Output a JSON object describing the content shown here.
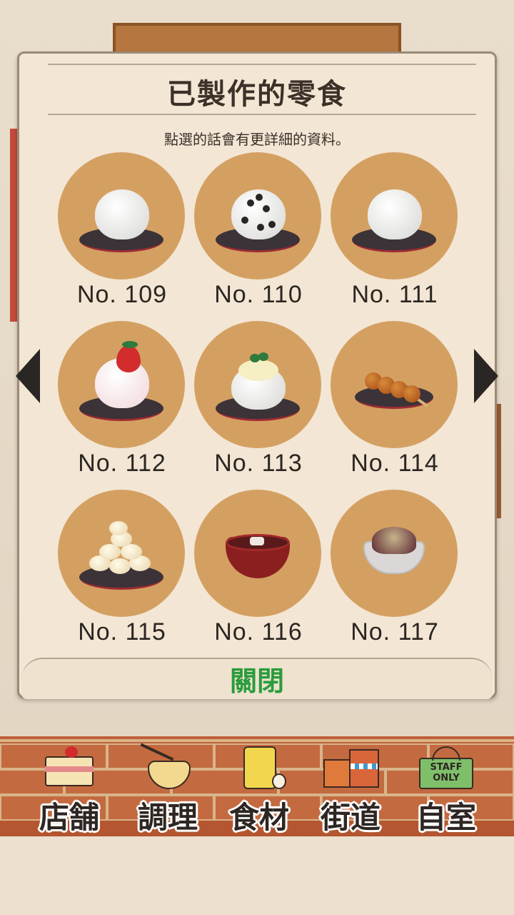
{
  "dialog": {
    "title": "已製作的零食",
    "subtitle": "點選的話會有更詳細的資料。",
    "close_label": "關閉"
  },
  "items": [
    {
      "number": "No. 109",
      "icon": "white-daifuku-icon"
    },
    {
      "number": "No. 110",
      "icon": "mame-daifuku-icon"
    },
    {
      "number": "No. 111",
      "icon": "white-daifuku-icon"
    },
    {
      "number": "No. 112",
      "icon": "strawberry-daifuku-icon"
    },
    {
      "number": "No. 113",
      "icon": "cream-daifuku-icon"
    },
    {
      "number": "No. 114",
      "icon": "dango-skewer-icon"
    },
    {
      "number": "No. 115",
      "icon": "steamed-buns-icon"
    },
    {
      "number": "No. 116",
      "icon": "red-bean-soup-icon"
    },
    {
      "number": "No. 117",
      "icon": "shaved-ice-icon"
    }
  ],
  "nav": [
    {
      "label": "店舗",
      "icon": "cake-icon"
    },
    {
      "label": "調理",
      "icon": "whisk-bowl-icon"
    },
    {
      "label": "食材",
      "icon": "flour-bag-icon"
    },
    {
      "label": "街道",
      "icon": "street-houses-icon"
    },
    {
      "label": "自室",
      "icon": "staff-only-sign-icon"
    }
  ],
  "nav_sign_text": "STAFF ONLY",
  "colors": {
    "item_circle": "#d4a062",
    "close_text": "#2a9c3c",
    "scroll_bg": "#f3e6d4"
  }
}
